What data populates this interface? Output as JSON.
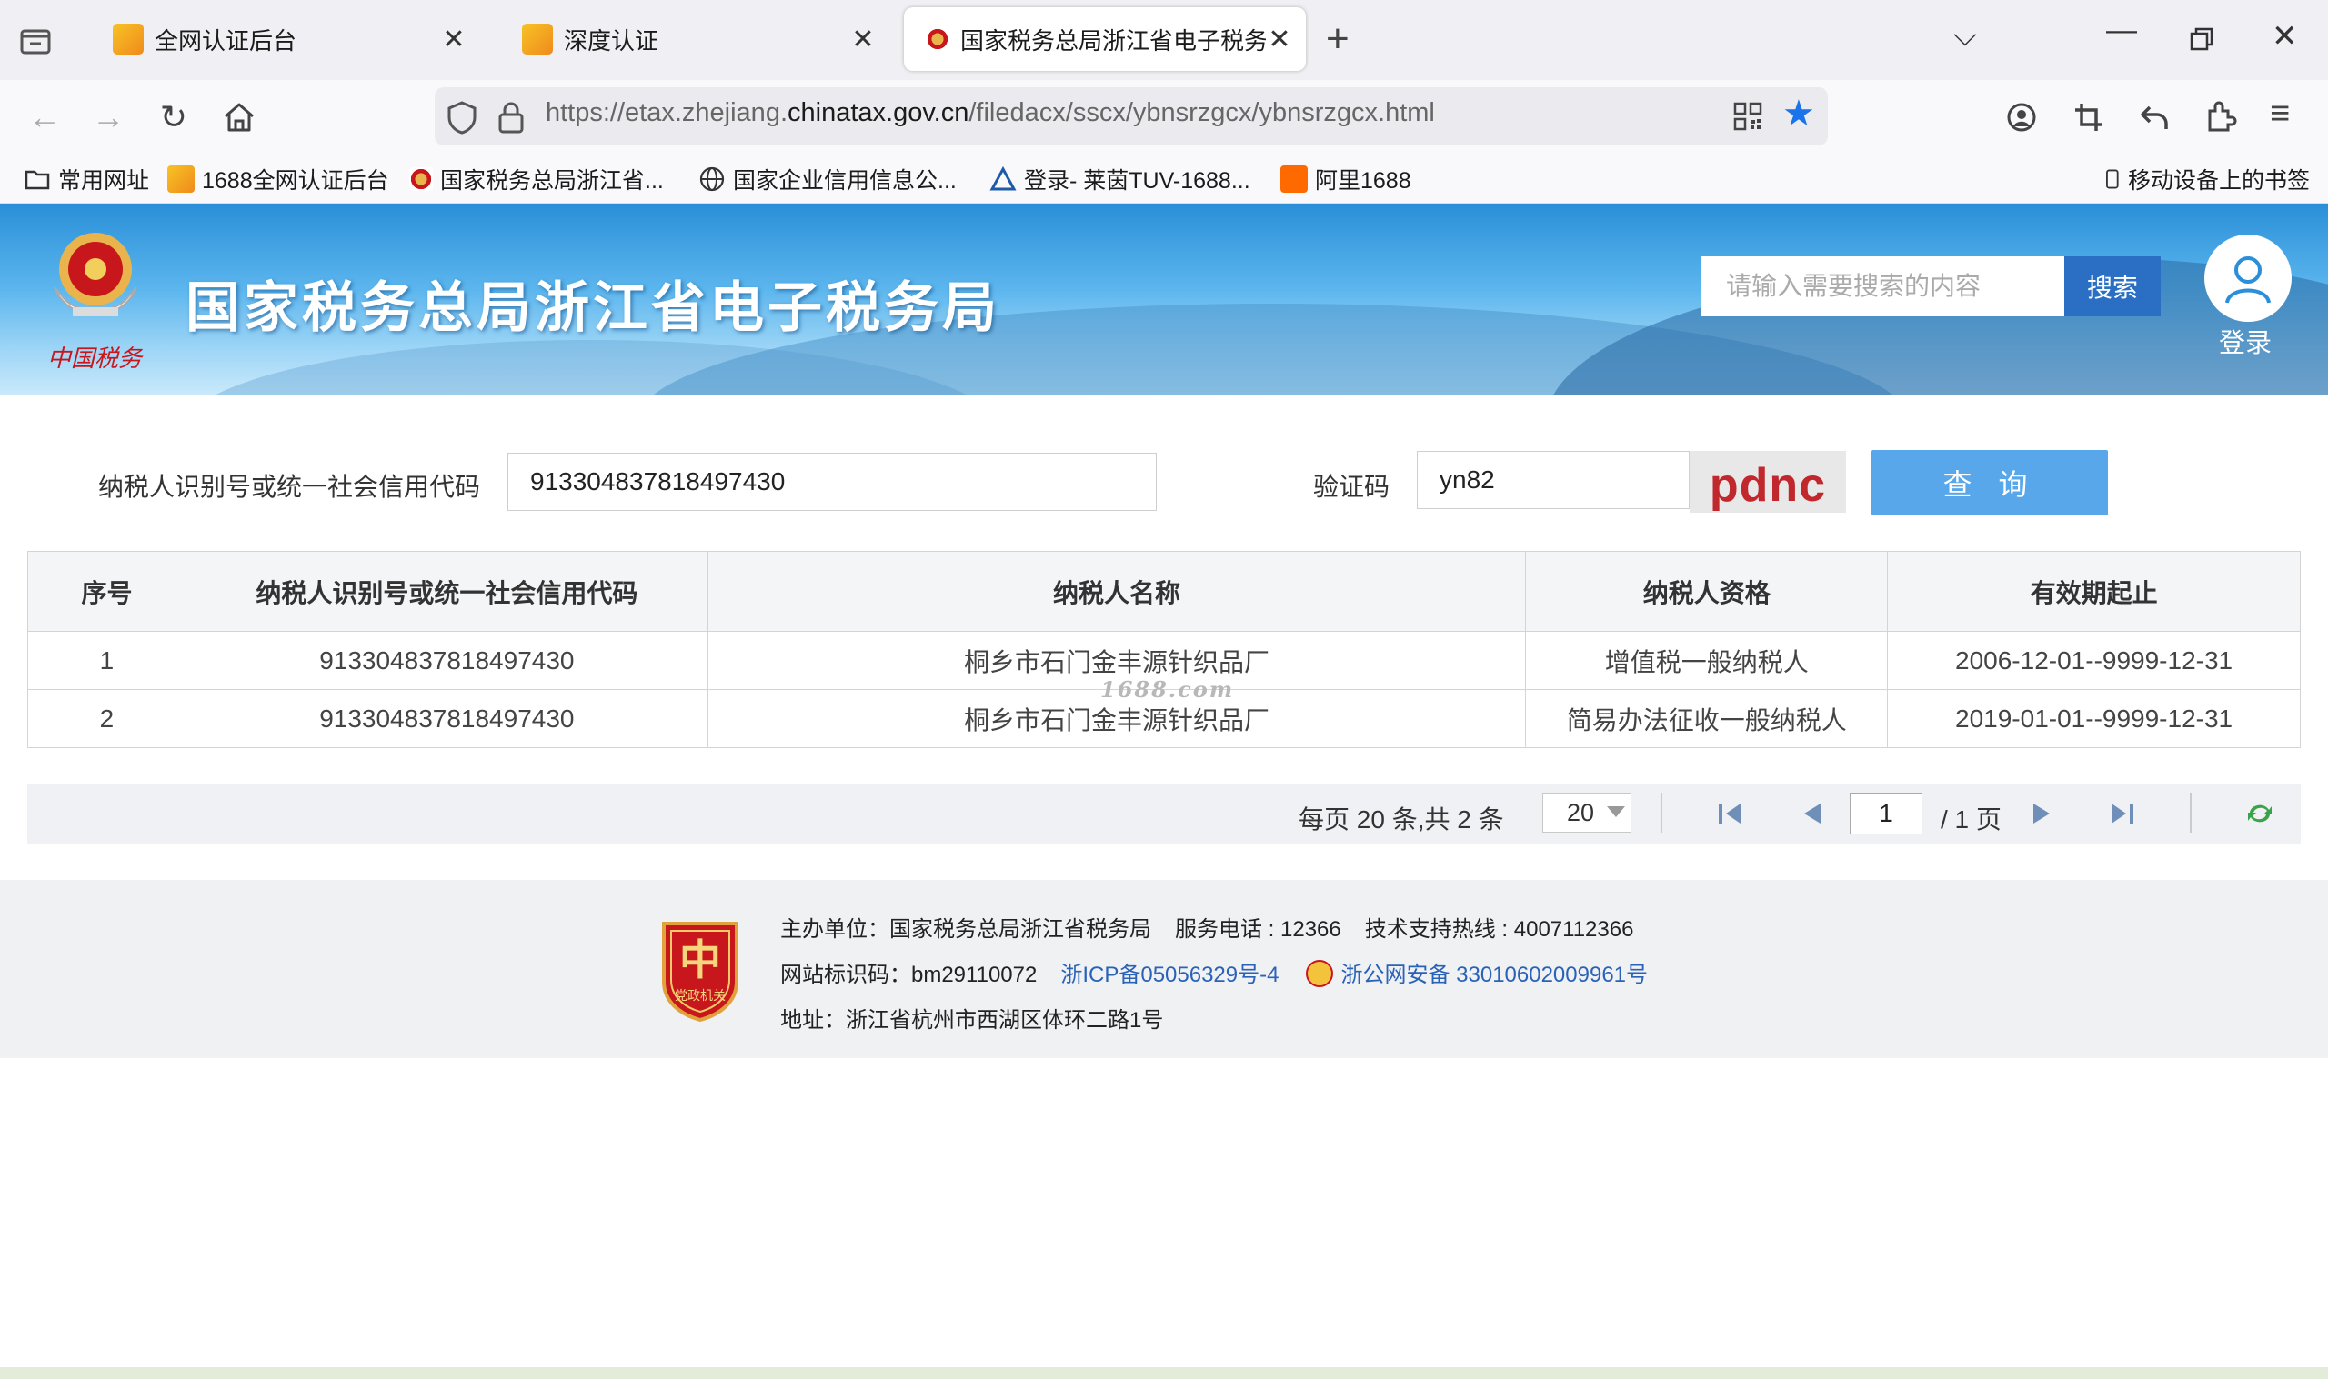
{
  "browser": {
    "tabs": [
      {
        "title": "全网认证后台",
        "active": false
      },
      {
        "title": "深度认证",
        "active": false
      },
      {
        "title": "国家税务总局浙江省电子税务局",
        "active": true
      }
    ],
    "url": {
      "prefix": "https://etax.zhejiang.",
      "domain": "chinatax.gov.cn",
      "path": "/filedacx/sscx/ybnsrzgcx/ybnsrzgcx.html"
    },
    "bookmarks": [
      {
        "label": "常用网址",
        "icon": "folder-icon"
      },
      {
        "label": "1688全网认证后台",
        "icon": "1688-favicon"
      },
      {
        "label": "国家税务总局浙江省...",
        "icon": "tax-emblem-favicon"
      },
      {
        "label": "国家企业信用信息公...",
        "icon": "globe-icon"
      },
      {
        "label": "登录- 莱茵TUV-1688...",
        "icon": "tuv-favicon"
      },
      {
        "label": "阿里1688",
        "icon": "ali1688-favicon"
      }
    ],
    "mobile_bookmarks": "移动设备上的书签"
  },
  "header": {
    "site_title": "国家税务总局浙江省电子税务局",
    "emblem_caption": "中国税务",
    "search_placeholder": "请输入需要搜索的内容",
    "search_button": "搜索",
    "login_label": "登录"
  },
  "form": {
    "taxid_label": "纳税人识别号或统一社会信用代码",
    "taxid_value": "913304837818497430",
    "captcha_label": "验证码",
    "captcha_value": "yn82",
    "captcha_image_text": "pdnc",
    "query_button": "查 询"
  },
  "table": {
    "headers": [
      "序号",
      "纳税人识别号或统一社会信用代码",
      "纳税人名称",
      "纳税人资格",
      "有效期起止"
    ],
    "rows": [
      [
        "1",
        "913304837818497430",
        "桐乡市石门金丰源针织品厂",
        "增值税一般纳税人",
        "2006-12-01--9999-12-31"
      ],
      [
        "2",
        "913304837818497430",
        "桐乡市石门金丰源针织品厂",
        "简易办法征收一般纳税人",
        "2019-01-01--9999-12-31"
      ]
    ],
    "watermark": "1688.com"
  },
  "pagination": {
    "summary": "每页 20 条,共 2 条",
    "page_size": "20",
    "current_page": "1",
    "total_pages": "/ 1 页"
  },
  "footer": {
    "logo_caption": "党政机关",
    "line1": {
      "sponsor": "主办单位：国家税务总局浙江省税务局",
      "phone": "服务电话 : 12366",
      "support": "技术支持热线 : 4007112366"
    },
    "line2": {
      "site_id": "网站标识码：bm29110072",
      "icp": "浙ICP备05056329号-4",
      "police": "浙公网安备 33010602009961号"
    },
    "line3": {
      "address": "地址：浙江省杭州市西湖区体环二路1号"
    }
  },
  "colors": {
    "primary_blue": "#2a6fc4",
    "query_button": "#57a7ea",
    "link": "#2a62b8",
    "captcha_red": "#c0282d"
  }
}
